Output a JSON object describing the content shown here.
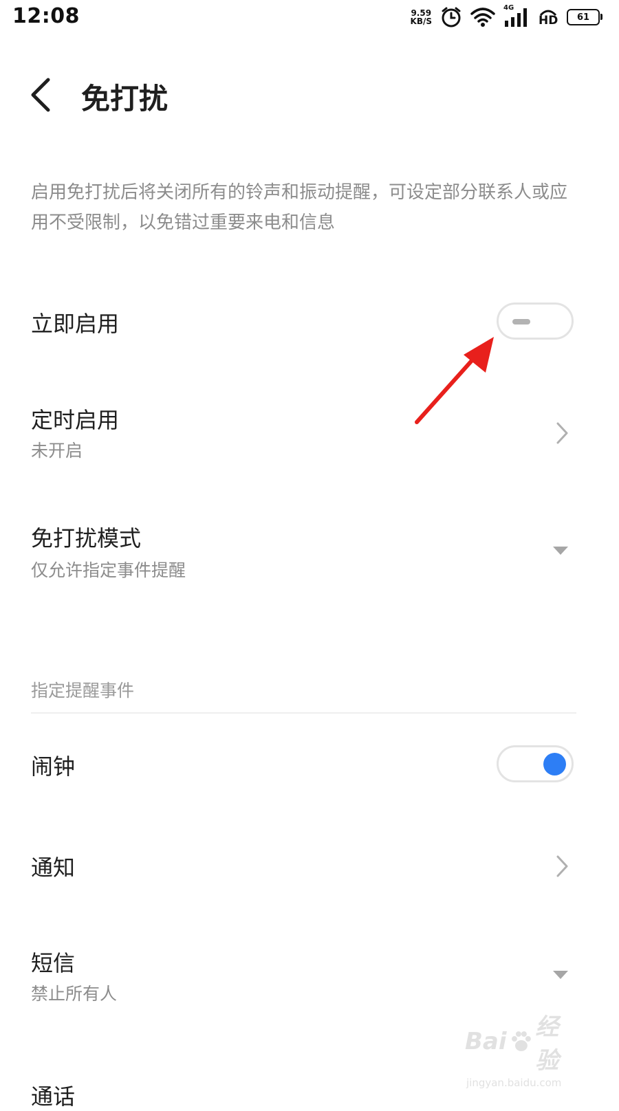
{
  "status_bar": {
    "time": "12:08",
    "speed_value": "9.59",
    "speed_unit": "KB/S",
    "network": "4G",
    "hd": "HD",
    "battery": "61",
    "icons": [
      "alarm-icon",
      "wifi-icon",
      "signal-icon",
      "hd-icon",
      "battery-icon"
    ]
  },
  "header": {
    "title": "免打扰"
  },
  "description": "启用免打扰后将关闭所有的铃声和振动提醒，可设定部分联系人或应用不受限制，以免错过重要来电和信息",
  "settings": {
    "enable_now": {
      "label": "立即启用",
      "enabled": false
    },
    "scheduled": {
      "label": "定时启用",
      "value": "未开启"
    },
    "mode": {
      "label": "免打扰模式",
      "value": "仅允许指定事件提醒"
    }
  },
  "events": {
    "section_title": "指定提醒事件",
    "alarm": {
      "label": "闹钟",
      "enabled": true
    },
    "notifications": {
      "label": "通知"
    },
    "sms": {
      "label": "短信",
      "value": "禁止所有人"
    },
    "calls": {
      "label": "通话"
    }
  },
  "watermark": {
    "brand_left": "Bai",
    "brand_right": "经验",
    "url": "jingyan.baidu.com"
  },
  "colors": {
    "accent": "#2d7ef5",
    "annotation_arrow": "#e8201c",
    "secondary_text": "#8c8c8c"
  }
}
